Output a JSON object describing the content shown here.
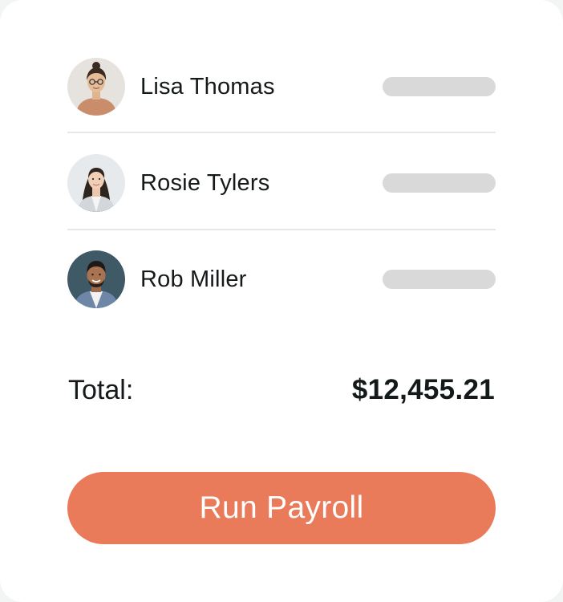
{
  "employees": [
    {
      "name": "Lisa Thomas",
      "avatar": "avatar-lisa-thomas"
    },
    {
      "name": "Rosie Tylers",
      "avatar": "avatar-rosie-tylers"
    },
    {
      "name": "Rob Miller",
      "avatar": "avatar-rob-miller"
    }
  ],
  "summary": {
    "total_label": "Total:",
    "total_value": "$12,455.21"
  },
  "actions": {
    "run_payroll_label": "Run Payroll"
  },
  "colors": {
    "accent": "#e97a5a",
    "placeholder": "#d9d9d9",
    "divider": "#e6e7e7",
    "text": "#14191a",
    "background": "#ffffff"
  }
}
